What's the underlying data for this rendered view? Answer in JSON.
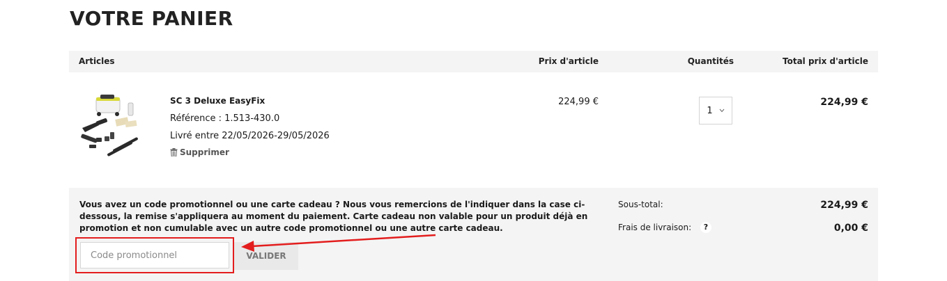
{
  "page": {
    "title": "VOTRE PANIER"
  },
  "table": {
    "headers": {
      "articles": "Articles",
      "unit_price": "Prix d'article",
      "quantity": "Quantités",
      "line_total": "Total prix d'article"
    }
  },
  "item": {
    "name": "SC 3 Deluxe EasyFix",
    "reference": "Référence : 1.513-430.0",
    "delivery": "Livré entre 22/05/2026-29/05/2026",
    "remove_label": "Supprimer",
    "unit_price": "224,99 €",
    "quantity": "1",
    "line_total": "224,99 €"
  },
  "promo": {
    "text": "Vous avez un code promotionnel ou une carte cadeau ? Nous vous remercions de l'indiquer dans la case ci-dessous, la remise s'appliquera au moment du paiement. Carte cadeau non valable pour un produit déjà en promotion et non cumulable avec un autre code promotionnel ou une autre carte cadeau.",
    "input_placeholder": "Code promotionnel",
    "input_value": "",
    "validate_label": "VALIDER"
  },
  "summary": {
    "subtotal_label": "Sous-total:",
    "subtotal_value": "224,99 €",
    "shipping_label": "Frais de livraison:",
    "shipping_help": "?",
    "shipping_value": "0,00 €"
  },
  "colors": {
    "highlight": "#e31d1d",
    "panel_bg": "#f4f4f4"
  },
  "icons": {
    "remove": "trash-icon",
    "quantity_dropdown": "chevron-down-icon",
    "annotation": "red-arrow-annotation"
  }
}
